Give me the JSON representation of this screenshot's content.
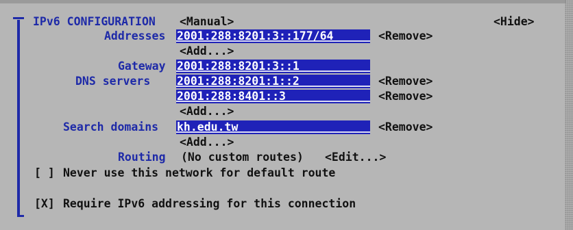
{
  "section": {
    "marker": "╤",
    "title": "IPv6 CONFIGURATION",
    "mode": "<Manual>",
    "hide": "<Hide>"
  },
  "addresses": {
    "label": "Addresses",
    "value": "2001:288:8201:3::177/64",
    "remove": "<Remove>",
    "add": "<Add...>"
  },
  "gateway": {
    "label": "Gateway",
    "value": "2001:288:8201:3::1"
  },
  "dns": {
    "label": "DNS servers",
    "entries": [
      {
        "value": "2001:288:8201:1::2",
        "remove": "<Remove>"
      },
      {
        "value": "2001:288:8401::3",
        "remove": "<Remove>"
      }
    ],
    "add": "<Add...>"
  },
  "search": {
    "label": "Search domains",
    "value": "kh.edu.tw",
    "remove": "<Remove>",
    "add": "<Add...>"
  },
  "routing": {
    "label": "Routing",
    "value": "(No custom routes)",
    "edit": "<Edit...>"
  },
  "checkboxes": {
    "never_default": {
      "box": "[ ]",
      "label": "Never use this network for default route"
    },
    "require_ipv6": {
      "box": "[X]",
      "label": "Require IPv6 addressing for this connection"
    }
  },
  "colors": {
    "accent": "#1e2aa8",
    "field_bg": "#1f22b8",
    "background": "#b6b6b6"
  }
}
